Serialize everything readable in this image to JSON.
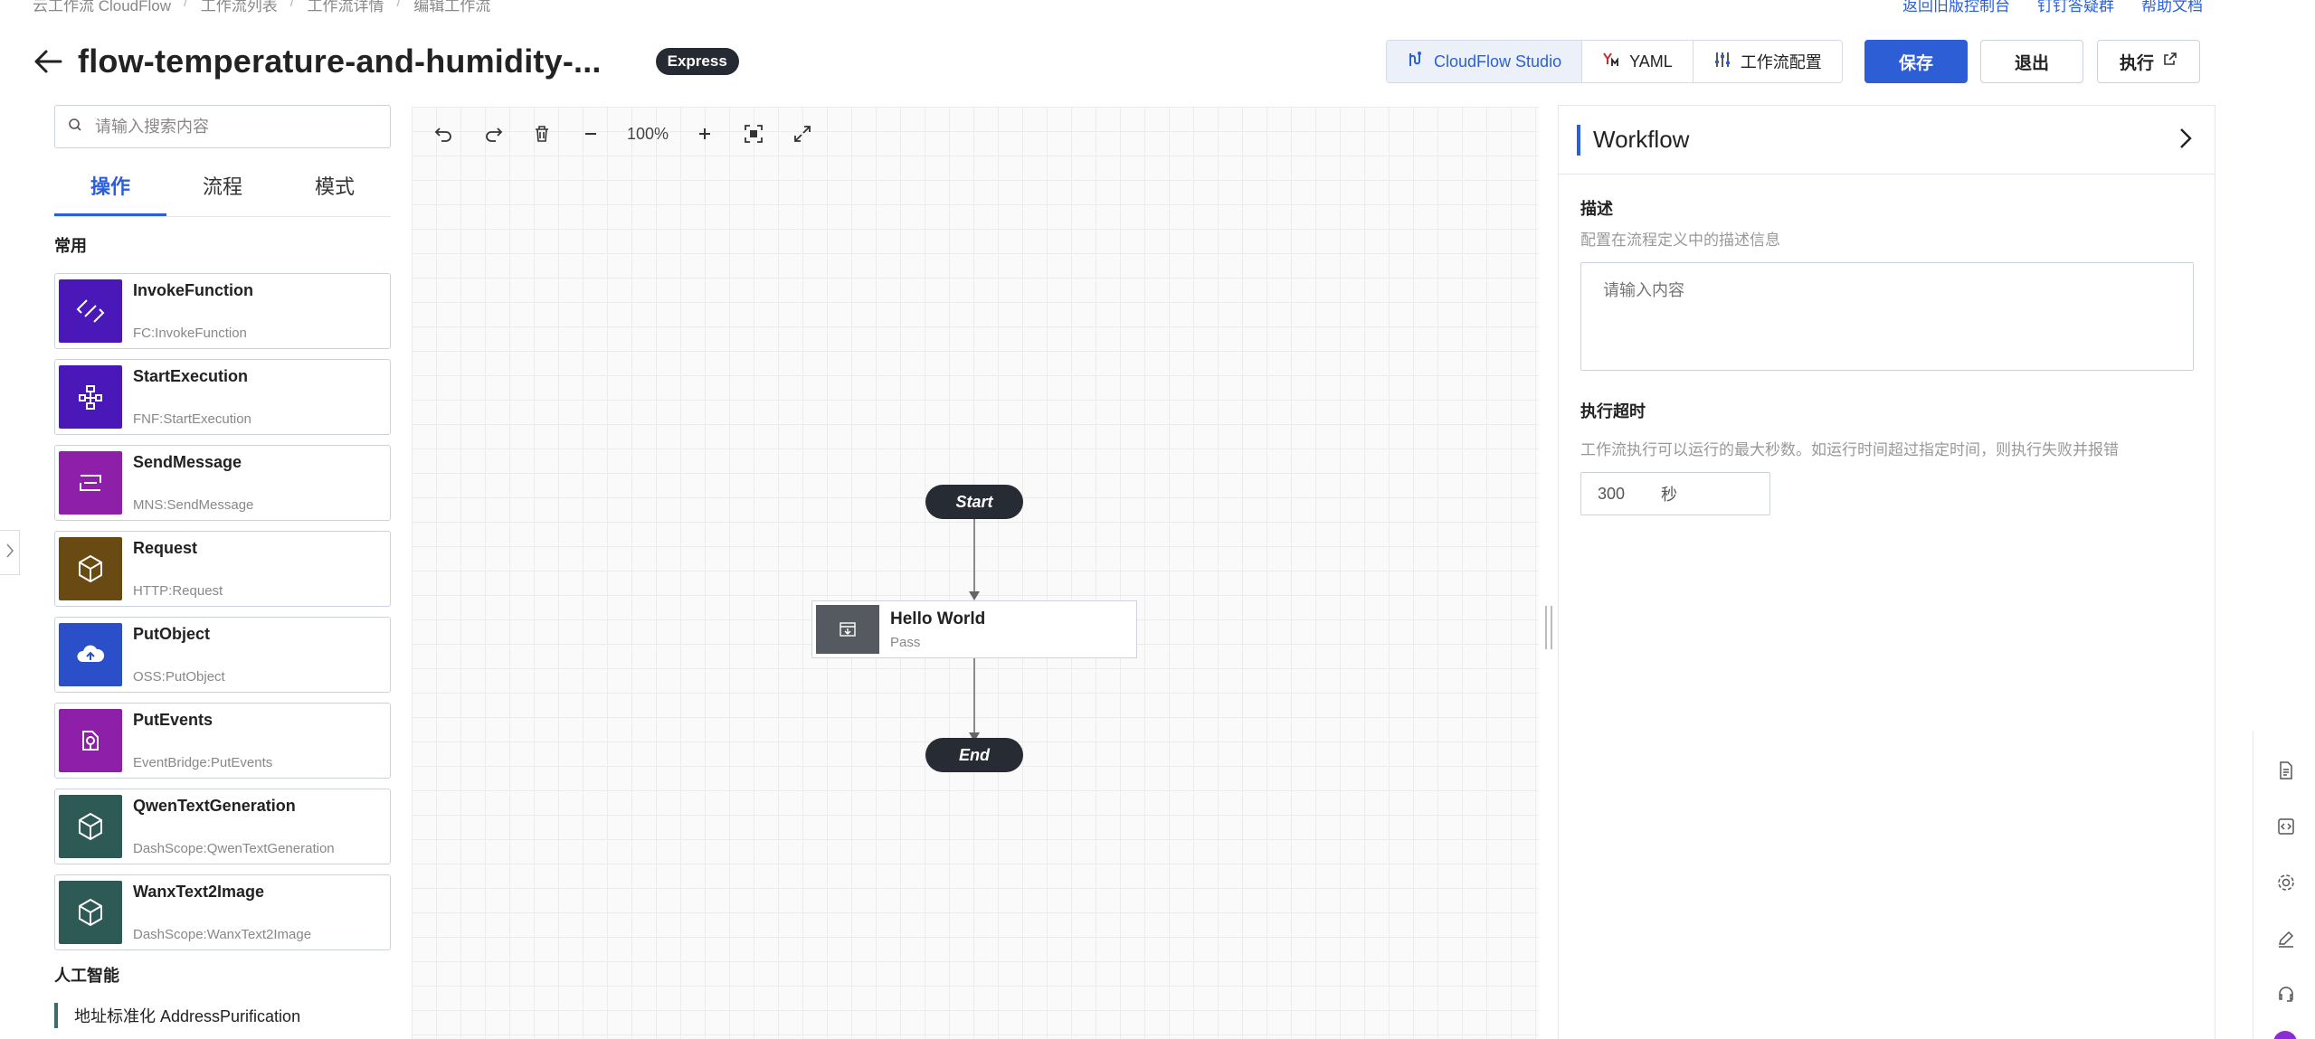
{
  "breadcrumb": [
    "云工作流 CloudFlow",
    "工作流列表",
    "工作流详情",
    "编辑工作流"
  ],
  "top_links": [
    "返回旧版控制台",
    "钉钉答疑群",
    "帮助文档"
  ],
  "header": {
    "title": "flow-temperature-and-humidity-...",
    "badge": "Express"
  },
  "toolbar": {
    "studio_label": "CloudFlow Studio",
    "yaml_label": "YAML",
    "config_label": "工作流配置",
    "save_label": "保存",
    "exit_label": "退出",
    "run_label": "执行"
  },
  "left_panel": {
    "search_placeholder": "请输入搜索内容",
    "tabs": [
      "操作",
      "流程",
      "模式"
    ],
    "common_heading": "常用",
    "actions": [
      {
        "name": "InvokeFunction",
        "sub": "FC:InvokeFunction",
        "color": "#4a17b8",
        "icon": "invoke-function-icon"
      },
      {
        "name": "StartExecution",
        "sub": "FNF:StartExecution",
        "color": "#4a17b8",
        "icon": "start-execution-icon"
      },
      {
        "name": "SendMessage",
        "sub": "MNS:SendMessage",
        "color": "#8d1fa8",
        "icon": "send-message-icon"
      },
      {
        "name": "Request",
        "sub": "HTTP:Request",
        "color": "#6a4a13",
        "icon": "request-cube-icon"
      },
      {
        "name": "PutObject",
        "sub": "OSS:PutObject",
        "color": "#2a4fc8",
        "icon": "cloud-upload-icon"
      },
      {
        "name": "PutEvents",
        "sub": "EventBridge:PutEvents",
        "color": "#8d1fa8",
        "icon": "put-events-icon"
      },
      {
        "name": "QwenTextGeneration",
        "sub": "DashScope:QwenTextGeneration",
        "color": "#2e5a55",
        "icon": "qwen-cube-icon"
      },
      {
        "name": "WanxText2Image",
        "sub": "DashScope:WanxText2Image",
        "color": "#2e5a55",
        "icon": "wanx-cube-icon"
      }
    ],
    "ai_heading": "人工智能",
    "ai_items": [
      "地址标准化 AddressPurification"
    ]
  },
  "canvas": {
    "zoom": "100%",
    "start_label": "Start",
    "end_label": "End",
    "state": {
      "name": "Hello World",
      "type": "Pass"
    }
  },
  "right_panel": {
    "title": "Workflow",
    "desc_label": "描述",
    "desc_hint": "配置在流程定义中的描述信息",
    "desc_placeholder": "请输入内容",
    "timeout_label": "执行超时",
    "timeout_hint": "工作流执行可以运行的最大秒数。如运行时间超过指定时间，则执行失败并报错",
    "timeout_value": "300",
    "timeout_unit": "秒"
  }
}
